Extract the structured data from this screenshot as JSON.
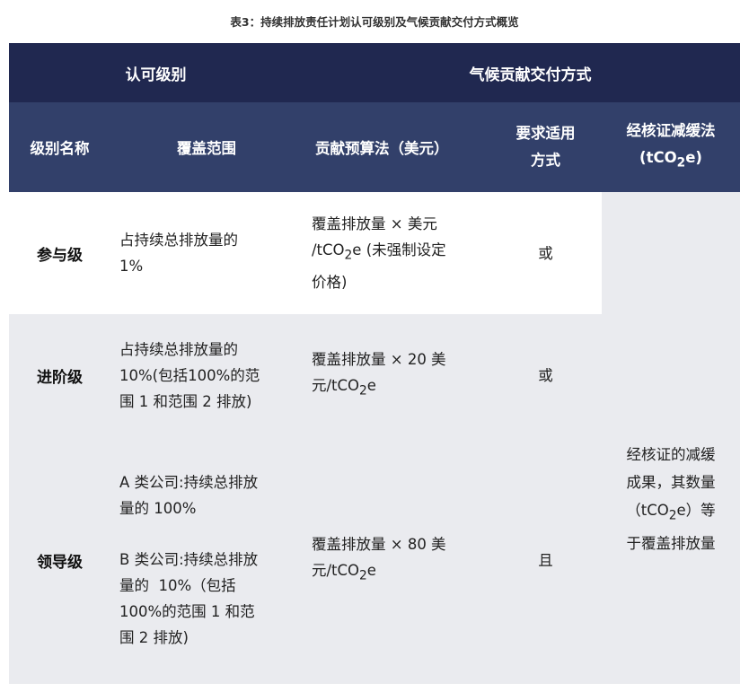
{
  "caption": "表3：持续排放责任计划认可级别及气候贡献交付方式概览",
  "header": {
    "group1": "认可级别",
    "group2": "气候贡献交付方式",
    "col_level": "级别名称",
    "col_scope": "覆盖范围",
    "col_budget": "贡献预算法（美元）",
    "col_method_line1": "要求适用",
    "col_method_line2": "方式",
    "col_verified_line1": "经核证减缓法",
    "col_verified_line2_pre": "(tCO",
    "col_verified_line2_sub": "2",
    "col_verified_line2_post": "e)"
  },
  "rows": [
    {
      "level": "参与级",
      "scope_lines": [
        "占持续总排放量的",
        "1%"
      ],
      "budget_line1": "覆盖排放量 × 美元",
      "budget_line2_pre": "/tCO",
      "budget_line2_post": "e (未强制设定",
      "budget_line3": "价格)",
      "method": "或"
    },
    {
      "level": "进阶级",
      "scope_lines": [
        "占持续总排放量的",
        "10%(包括100%的范",
        "围 1 和范围 2 排放)"
      ],
      "budget_line1": "覆盖排放量 × 20 美",
      "budget_line2_pre": "元/tCO",
      "budget_line2_post": "e",
      "method": "或"
    },
    {
      "level": "领导级",
      "scope_a_lines": [
        "A 类公司:持续总排放",
        "量的 100%"
      ],
      "scope_b_lines": [
        "B 类公司:持续总排放",
        "量的  10%（包括",
        "100%的范围 1 和范",
        "围 2 排放)"
      ],
      "budget_line1": "覆盖排放量 × 80 美",
      "budget_line2_pre": "元/tCO",
      "budget_line2_post": "e",
      "method": "且"
    }
  ],
  "verified": {
    "line1": "经核证的减缓",
    "line2": "成果，其数量",
    "line3_pre": "（tCO",
    "line3_post": "e）等",
    "line4": "于覆盖排放量"
  },
  "sub2": "2",
  "colors": {
    "header_dark": "#202850",
    "header_mid": "#32406a",
    "row_shade": "#eaebef"
  }
}
